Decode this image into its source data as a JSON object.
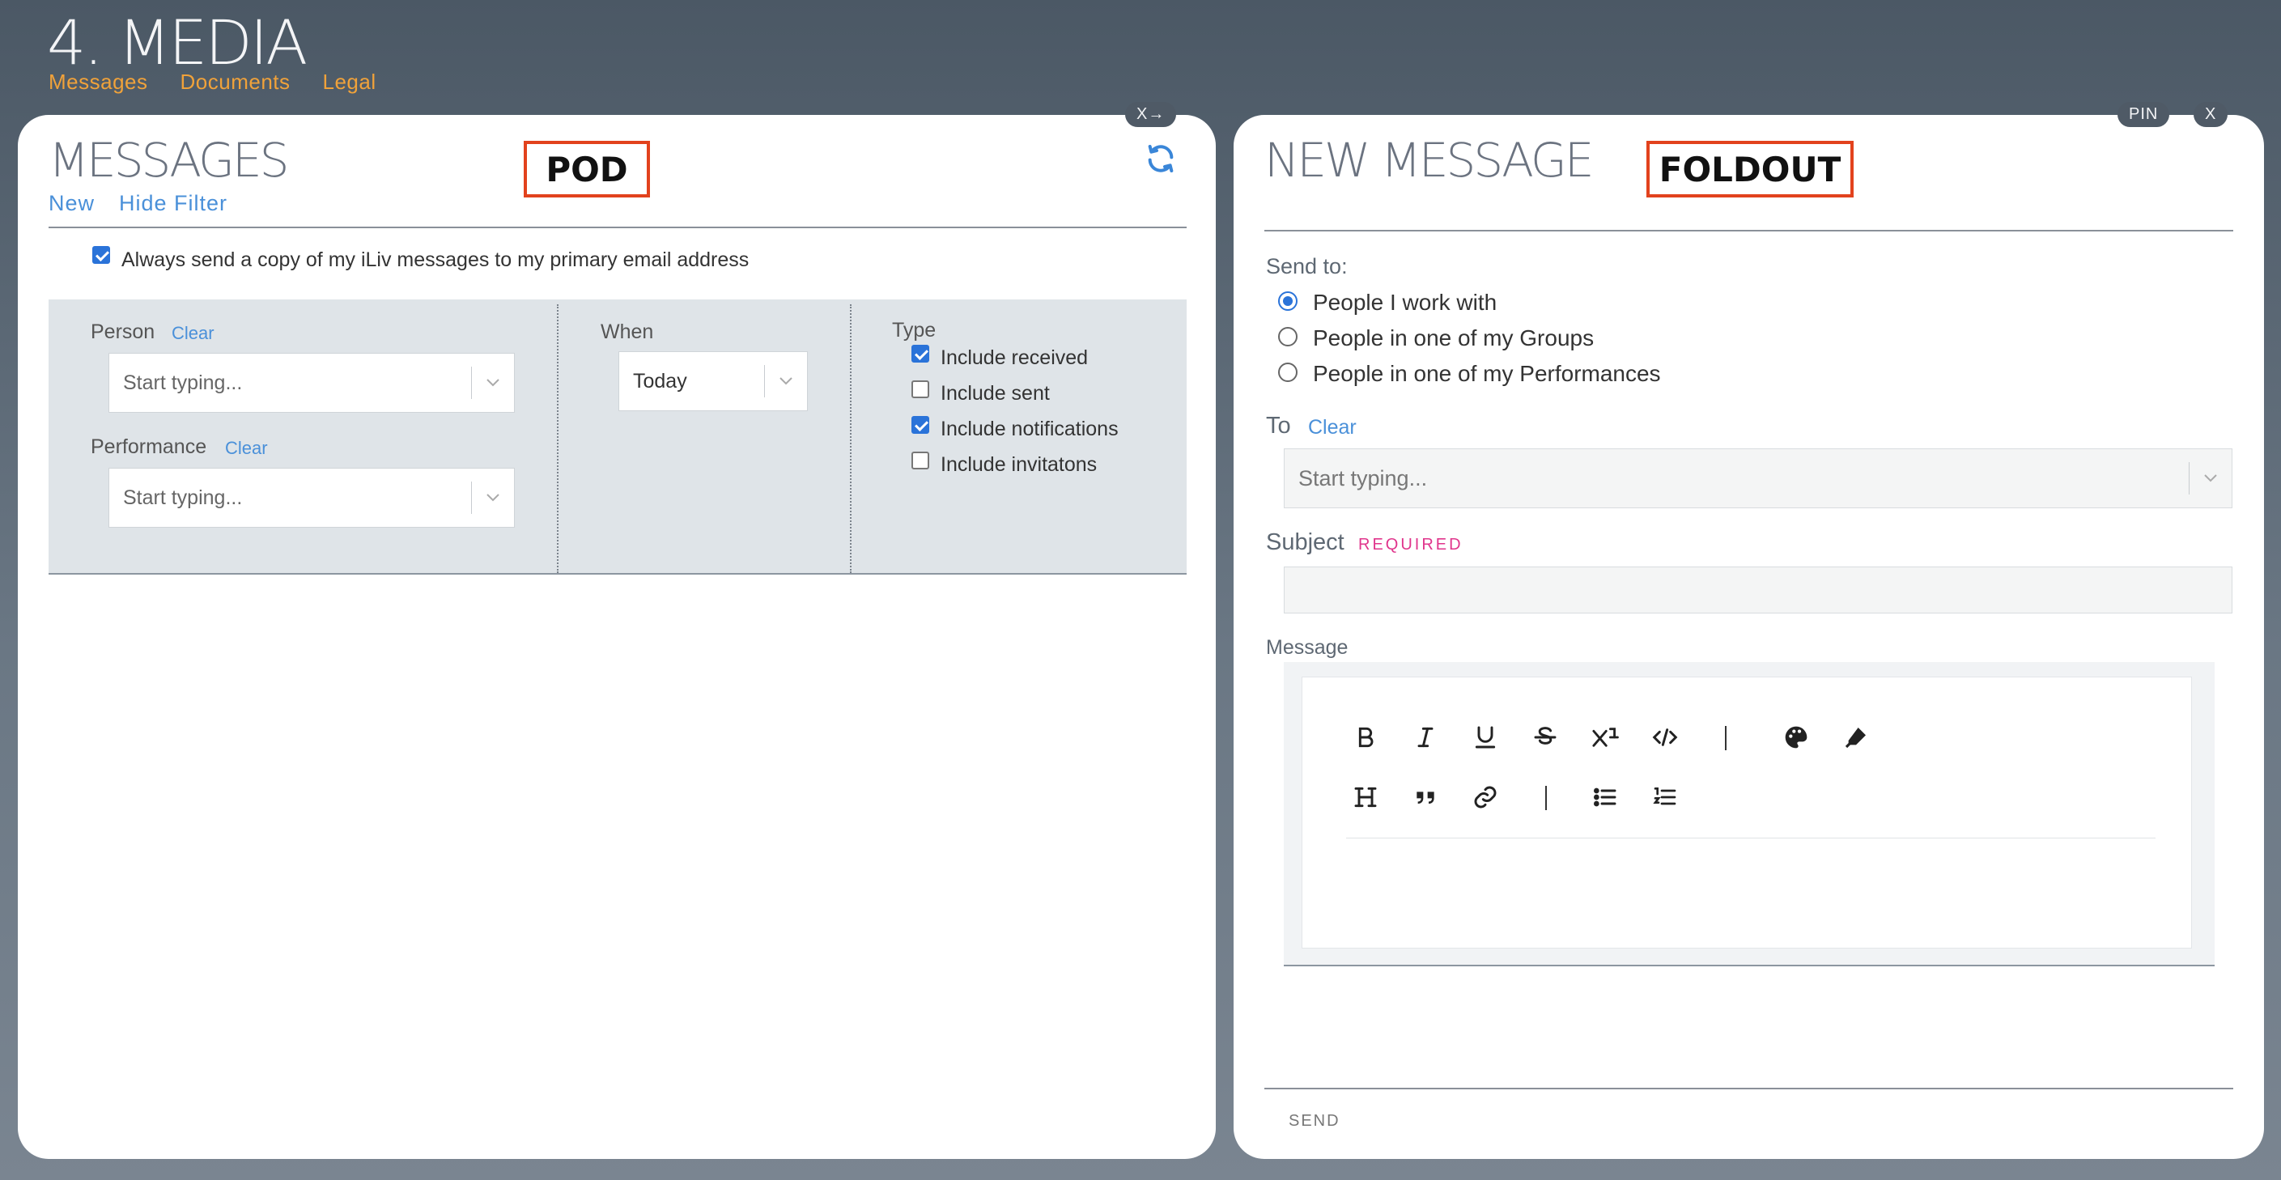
{
  "page": {
    "title": "4. MEDIA",
    "nav": [
      "Messages",
      "Documents",
      "Legal"
    ]
  },
  "left_pod": {
    "close_label": "X→",
    "title": "MESSAGES",
    "annotation": "POD",
    "actions": {
      "new": "New",
      "hide_filter": "Hide Filter"
    },
    "copy_checkbox": {
      "label": "Always send a copy of my iLiv messages to my primary email address",
      "checked": true
    },
    "filter": {
      "person": {
        "label": "Person",
        "clear": "Clear",
        "placeholder": "Start typing..."
      },
      "performance": {
        "label": "Performance",
        "clear": "Clear",
        "placeholder": "Start typing..."
      },
      "when": {
        "label": "When",
        "value": "Today"
      },
      "type": {
        "label": "Type",
        "options": [
          {
            "label": "Include received",
            "checked": true
          },
          {
            "label": "Include sent",
            "checked": false
          },
          {
            "label": "Include notifications",
            "checked": true
          },
          {
            "label": "Include invitatons",
            "checked": false
          }
        ]
      }
    }
  },
  "right_pod": {
    "pin_label": "PIN",
    "close_label": "X",
    "title": "NEW MESSAGE",
    "annotation": "FOLDOUT",
    "send_to_label": "Send to:",
    "send_to_options": [
      {
        "label": "People I work with",
        "selected": true
      },
      {
        "label": "People in one of my Groups",
        "selected": false
      },
      {
        "label": "People in one of my Performances",
        "selected": false
      }
    ],
    "to": {
      "label": "To",
      "clear": "Clear",
      "placeholder": "Start typing..."
    },
    "subject": {
      "label": "Subject",
      "required": "REQUIRED",
      "value": ""
    },
    "message_label": "Message",
    "toolbar_row1": [
      "bold-icon",
      "italic-icon",
      "underline-icon",
      "strikethrough-icon",
      "superscript-icon",
      "code-icon",
      "separator",
      "palette-icon",
      "highlighter-icon"
    ],
    "toolbar_row2": [
      "heading-icon",
      "quote-icon",
      "link-icon",
      "separator",
      "bullet-list-icon",
      "numbered-list-icon"
    ],
    "send_label": "SEND"
  },
  "colors": {
    "accent": "#2a73d9",
    "nav": "#f0a23a",
    "annotation": "#e2421d",
    "required": "#e0358c"
  }
}
